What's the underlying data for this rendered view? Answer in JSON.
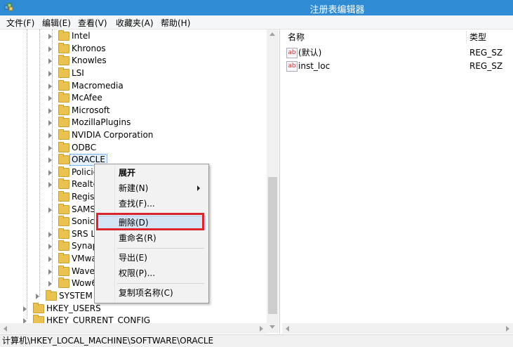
{
  "window": {
    "title": "注册表编辑器",
    "title_color": "#2e8bd4"
  },
  "menubar": [
    "文件(F)",
    "编辑(E)",
    "查看(V)",
    "收藏夹(A)",
    "帮助(H)"
  ],
  "tree": {
    "software_children": [
      "Intel",
      "Khronos",
      "Knowles",
      "LSI",
      "Macromedia",
      "McAfee",
      "Microsoft",
      "MozillaPlugins",
      "NVIDIA Corporation",
      "ODBC",
      "ORACLE",
      "Policie",
      "Realte",
      "Regis",
      "SAMS",
      "Sonic",
      "SRS L",
      "Synap",
      "VMwa",
      "Wave",
      "Wow6"
    ],
    "selected": "ORACLE",
    "system": "SYSTEM",
    "hkey_users": "HKEY_USERS",
    "hkey_current_config": "HKEY_CURRENT_CONFIG"
  },
  "values_pane": {
    "col_name": "名称",
    "col_type": "类型",
    "rows": [
      {
        "icon": "ab",
        "name": "(默认)",
        "type": "REG_SZ"
      },
      {
        "icon": "ab",
        "name": "inst_loc",
        "type": "REG_SZ"
      }
    ]
  },
  "context_menu": {
    "items": [
      "展开",
      "新建(N)",
      "查找(F)...",
      "删除(D)",
      "重命名(R)",
      "导出(E)",
      "权限(P)...",
      "复制项名称(C)"
    ],
    "highlighted": "删除(D)",
    "highlight_outline_color": "#d9252b"
  },
  "status": {
    "path": "计算机\\HKEY_LOCAL_MACHINE\\SOFTWARE\\ORACLE"
  }
}
